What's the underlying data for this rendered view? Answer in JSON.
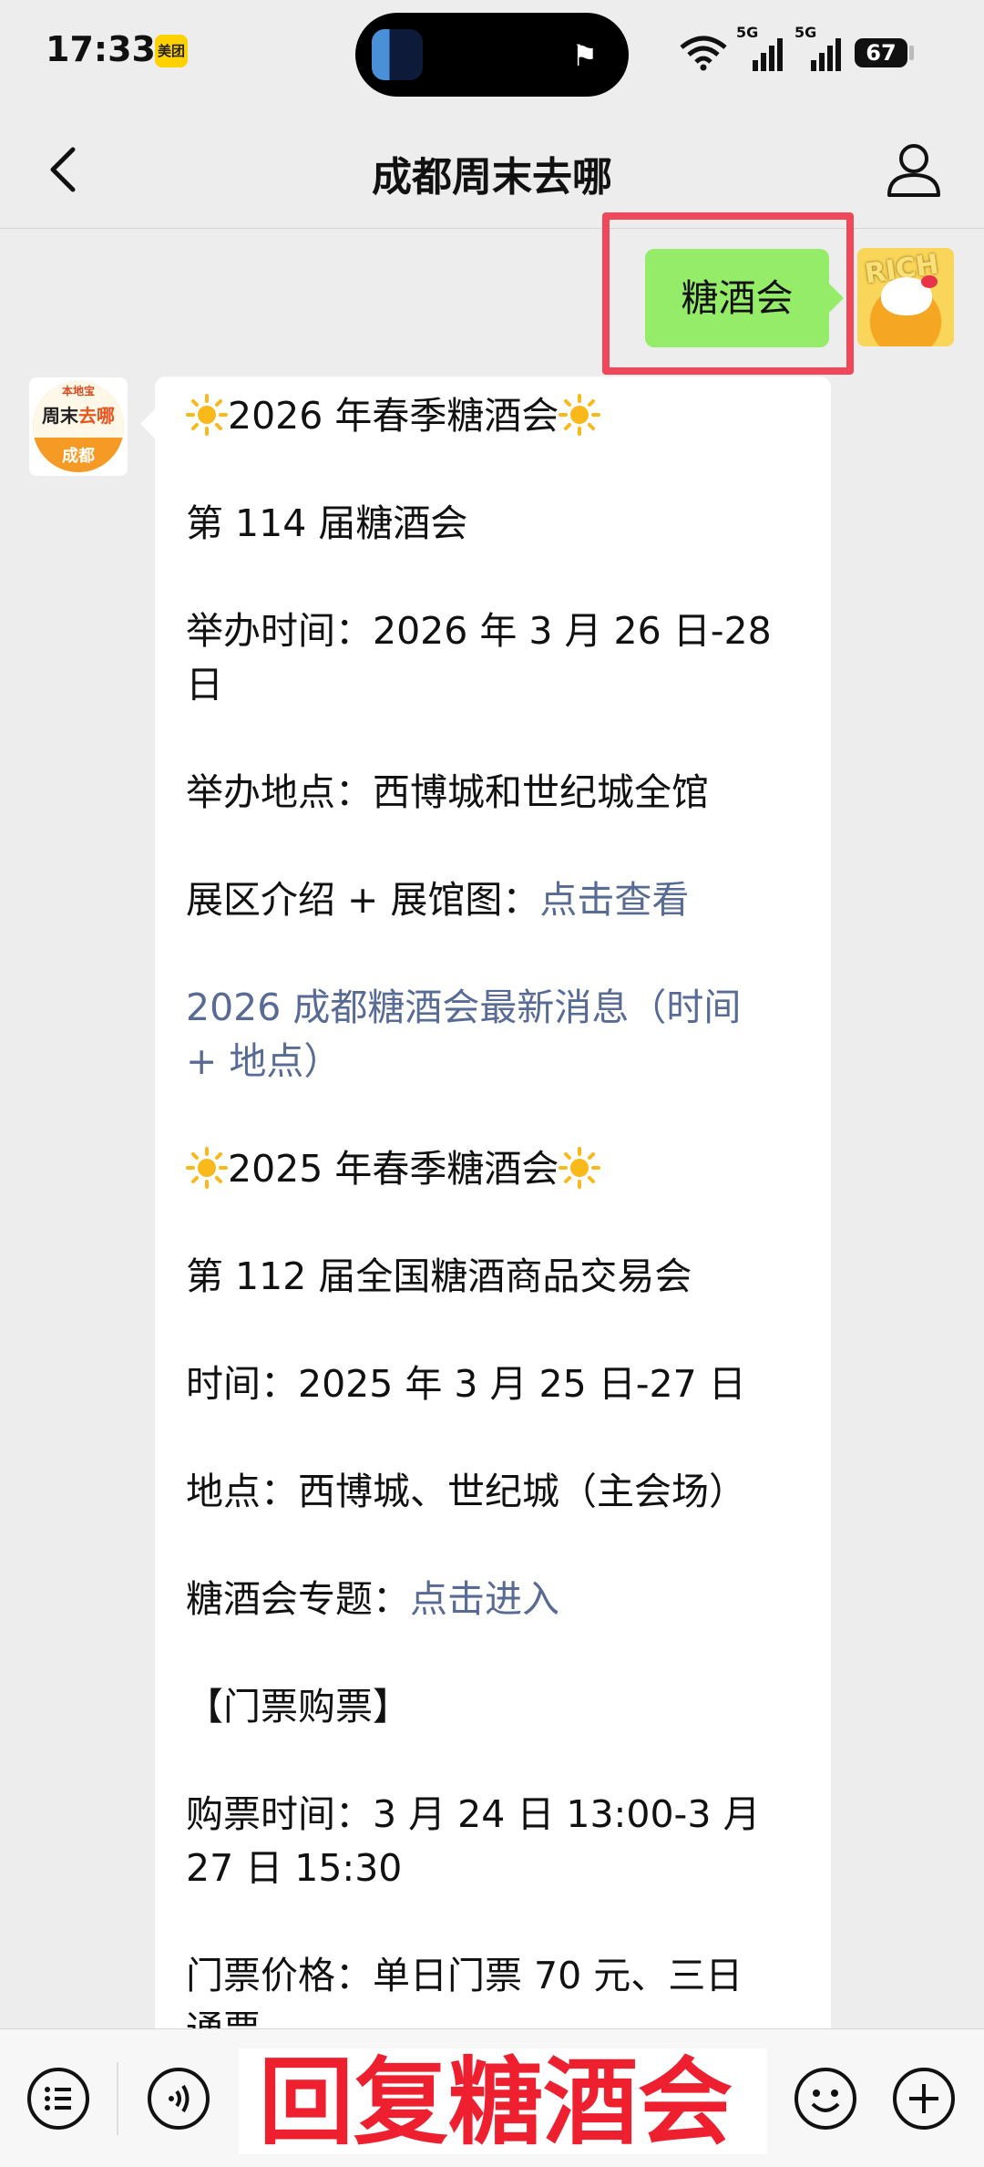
{
  "status_bar": {
    "time": "17:33",
    "app_badge": "美团",
    "network_1": "5G",
    "network_2": "5G",
    "battery": "67"
  },
  "nav": {
    "title": "成都周末去哪"
  },
  "chat": {
    "outgoing_message": "糖酒会",
    "my_avatar_text": "RICH",
    "bot_avatar": {
      "brand": "本地宝",
      "name_part1": "周末",
      "name_part2": "去哪",
      "city": "成都"
    },
    "reply": {
      "l1": "2026 年春季糖酒会",
      "l2": "第 114 届糖酒会",
      "l3a": "举办时间：2026 年 3 月 26 日-28",
      "l3b": "日",
      "l4": "举办地点：西博城和世纪城全馆",
      "l5_prefix": "展区介绍 + 展馆图：",
      "l5_link": "点击查看",
      "l6a": "2026 成都糖酒会最新消息（时间",
      "l6b": "+ 地点）",
      "l7": "2025 年春季糖酒会",
      "l8": "第 112 届全国糖酒商品交易会",
      "l9": "时间：2025 年 3 月 25 日-27 日",
      "l10": "地点：西博城、世纪城（主会场）",
      "l11_prefix": "糖酒会专题：",
      "l11_link": "点击进入",
      "l12": "【门票购票】",
      "l13a": "购票时间：3 月 24 日 13:00-3 月",
      "l13b": "27 日 15:30",
      "l14": "门票价格：单日门票 70 元、三日",
      "l15": "通票"
    }
  },
  "toolbar": {
    "overlay_text": "回复糖酒会"
  },
  "colors": {
    "outgoing_bubble": "#95ec69",
    "link": "#576b95",
    "highlight": "#f0485a",
    "overlay_text": "#ee1f2f"
  }
}
